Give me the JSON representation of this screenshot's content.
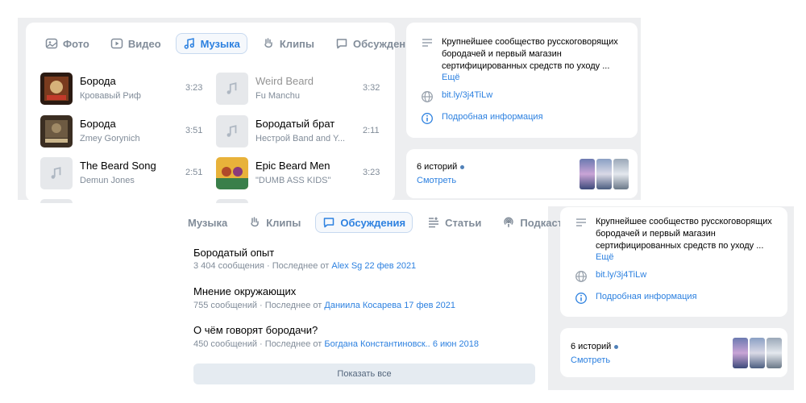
{
  "colors": {
    "accent": "#2d81e0",
    "muted": "#818c99",
    "background": "#edeef0"
  },
  "top_tabs": [
    {
      "label": "Фото",
      "icon": "photo-icon"
    },
    {
      "label": "Видео",
      "icon": "video-icon"
    },
    {
      "label": "Музыка",
      "icon": "music-note-icon",
      "active": true
    },
    {
      "label": "Клипы",
      "icon": "clips-icon"
    },
    {
      "label": "Обсуждения",
      "icon": "discussion-icon"
    }
  ],
  "tracks_left": [
    {
      "title": "Борода",
      "artist": "Кровавый Риф",
      "duration": "3:23",
      "cover": "album-art"
    },
    {
      "title": "Борода",
      "artist": "Zmey Gorynich",
      "duration": "3:51",
      "cover": "album-art"
    },
    {
      "title": "The Beard Song",
      "artist": "Demun Jones",
      "duration": "2:51",
      "cover": "music-note-icon"
    }
  ],
  "tracks_right": [
    {
      "title": "Weird Beard",
      "artist": "Fu Manchu",
      "duration": "3:32",
      "cover": "music-note-icon",
      "dimmed": true
    },
    {
      "title": "Бородатый брат",
      "artist": "Нестрой Band and Y...",
      "duration": "2:11",
      "cover": "music-note-icon"
    },
    {
      "title": "Epic Beard Men",
      "artist": "\"DUMB ASS KIDS\"",
      "duration": "3:23",
      "cover": "album-art"
    }
  ],
  "info": {
    "description": "Крупнейшее сообщество русскоговорящих бородачей и первый магазин сертифицированных средств по уходу ...",
    "more_label": "Ещё",
    "link": "bit.ly/3j4TiLw",
    "details_label": "Подробная информация"
  },
  "stories": {
    "count": "6 историй",
    "watch_label": "Смотреть"
  },
  "bottom_tabs": [
    {
      "label": "Музыка",
      "icon": ""
    },
    {
      "label": "Клипы",
      "icon": "clips-icon"
    },
    {
      "label": "Обсуждения",
      "icon": "discussion-icon",
      "active": true
    },
    {
      "label": "Статьи",
      "icon": "articles-icon"
    },
    {
      "label": "Подкасты",
      "icon": "podcast-icon"
    }
  ],
  "discussions": [
    {
      "title": "Бородатый опыт",
      "count": "3 404 сообщения",
      "sep": "·",
      "last_prefix": "Последнее от",
      "author": "Alex Sg",
      "date": "22 фев 2021"
    },
    {
      "title": "Мнение окружающих",
      "count": "755 сообщений",
      "sep": "·",
      "last_prefix": "Последнее от",
      "author": "Даниила Косарева",
      "date": "17 фев 2021"
    },
    {
      "title": "О чём говорят бородачи?",
      "count": "450 сообщений",
      "sep": "·",
      "last_prefix": "Последнее от",
      "author": "Богдана Константиновск..",
      "date": "6 июн 2018"
    }
  ],
  "show_all_label": "Показать все"
}
